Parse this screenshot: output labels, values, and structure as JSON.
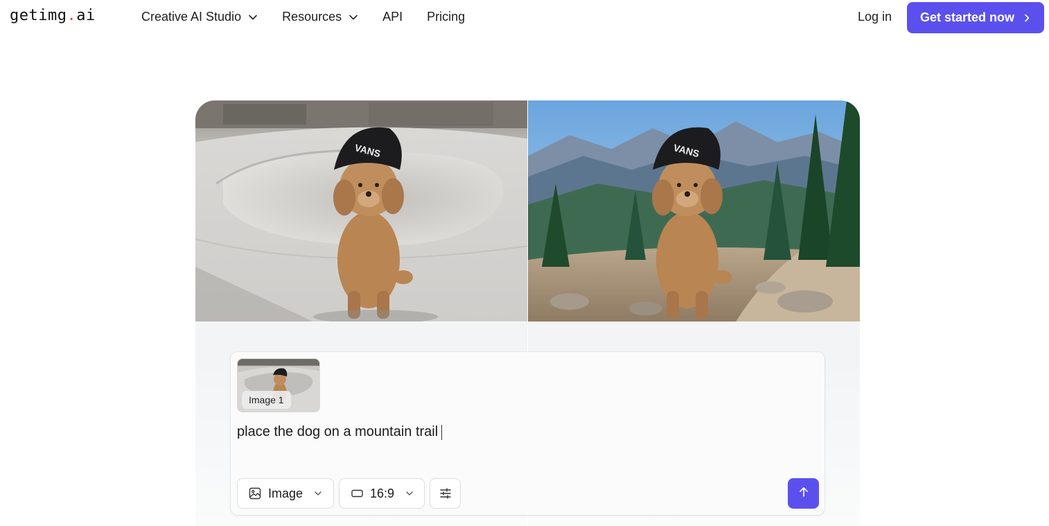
{
  "header": {
    "logo_main": "getimg",
    "logo_dot": ".",
    "logo_suffix": "ai",
    "nav": [
      {
        "label": "Creative AI Studio",
        "has_dropdown": true
      },
      {
        "label": "Resources",
        "has_dropdown": true
      },
      {
        "label": "API",
        "has_dropdown": false
      },
      {
        "label": "Pricing",
        "has_dropdown": false
      }
    ],
    "login_label": "Log in",
    "cta_label": "Get started now"
  },
  "showcase": {
    "images": [
      {
        "subject": "poodle-in-beanie",
        "scene": "skatepark"
      },
      {
        "subject": "poodle-in-beanie",
        "scene": "mountain-trail"
      }
    ],
    "beanie_text": "VANS"
  },
  "prompt": {
    "attachment_label": "Image 1",
    "text": "place the dog on a mountain trail",
    "mode_label": "Image",
    "ratio_label": "16:9",
    "icons": {
      "mode": "image-icon",
      "ratio": "aspect-ratio-icon",
      "settings": "sliders-icon",
      "send": "arrow-up-icon"
    }
  },
  "colors": {
    "accent": "#5b50ee",
    "logo_dot": "#e0454a",
    "text": "#1b1b1f"
  }
}
